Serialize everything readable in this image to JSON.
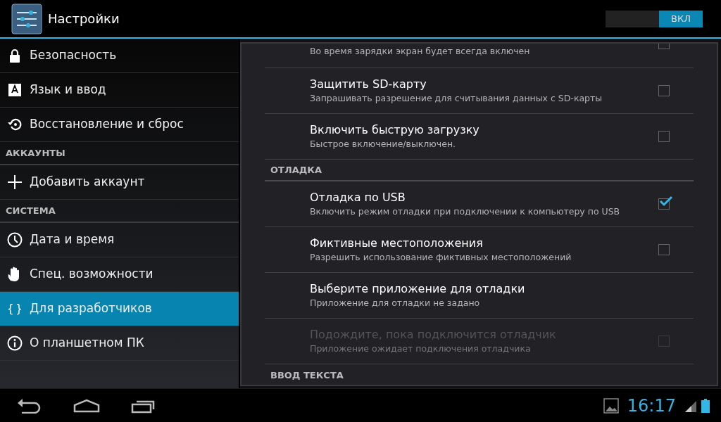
{
  "action_bar": {
    "title": "Настройки",
    "toggle": {
      "label": "ВКЛ",
      "on": true
    }
  },
  "sidebar": {
    "items": [
      {
        "kind": "item",
        "label": "Безопасность",
        "selected": false
      },
      {
        "kind": "item",
        "label": "Язык и ввод",
        "selected": false
      },
      {
        "kind": "item",
        "label": "Восстановление и сброс",
        "selected": false
      },
      {
        "kind": "header",
        "label": "АККАУНТЫ"
      },
      {
        "kind": "item",
        "label": "Добавить аккаунт",
        "selected": false
      },
      {
        "kind": "header",
        "label": "СИСТЕМА"
      },
      {
        "kind": "item",
        "label": "Дата и время",
        "selected": false
      },
      {
        "kind": "item",
        "label": "Спец. возможности",
        "selected": false
      },
      {
        "kind": "glyph_item",
        "glyph": "{ }",
        "label": "Для разработчиков",
        "selected": true
      },
      {
        "kind": "item",
        "label": "О планшетном ПК",
        "selected": false
      }
    ]
  },
  "settings": {
    "rows": [
      {
        "kind": "partial",
        "summary": "Во время зарядки экран будет всегда включен",
        "checked": false
      },
      {
        "kind": "checkbox",
        "title": "Защитить SD-карту",
        "summary": "Запрашивать разрешение для считывания данных с SD-карты",
        "checked": false,
        "disabled": false
      },
      {
        "kind": "checkbox",
        "title": "Включить быструю загрузку",
        "summary": "Быстрое включение/выключен.",
        "checked": false,
        "disabled": false
      },
      {
        "kind": "header",
        "title": "ОТЛАДКА"
      },
      {
        "kind": "checkbox",
        "title": "Отладка по USB",
        "summary": "Включить режим отладки при подключении к компьютеру по USB",
        "checked": true,
        "disabled": false
      },
      {
        "kind": "checkbox",
        "title": "Фиктивные местоположения",
        "summary": "Разрешить использование фиктивных местоположений",
        "checked": false,
        "disabled": false
      },
      {
        "kind": "text",
        "title": "Выберите приложение для отладки",
        "summary": "Приложение для отладки не задано",
        "disabled": false
      },
      {
        "kind": "checkbox",
        "title": "Подождите, пока подключится отладчик",
        "summary": "Приложение ожидает подключения отладчика",
        "checked": false,
        "disabled": true
      },
      {
        "kind": "header",
        "title": "ВВОД ТЕКСТА"
      }
    ]
  },
  "navigation_bar": {
    "clock": "16:17"
  }
}
